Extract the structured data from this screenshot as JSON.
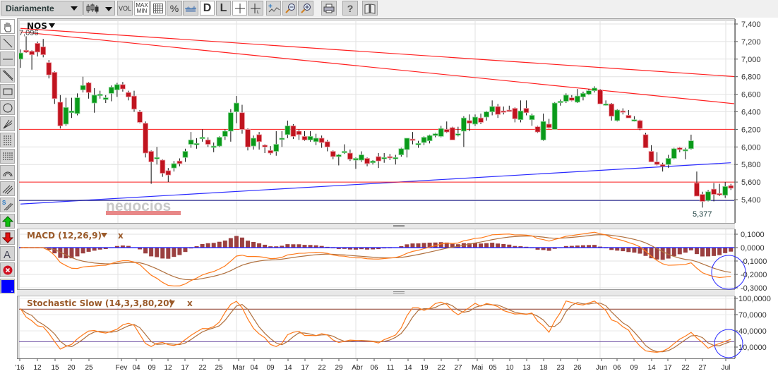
{
  "toolbar": {
    "period": "Diariamente",
    "vol": "VOL",
    "max": "MAX",
    "min": "MIN",
    "percent": "%",
    "d": "D",
    "l": "L",
    "help": "?"
  },
  "chart": {
    "symbol": "NOS",
    "high_label": "7,096",
    "low_label": "5,377",
    "watermark": "negocios"
  },
  "macd": {
    "title": "MACD (12,26,9)",
    "close": "x"
  },
  "stoch": {
    "title": "Stochastic Slow (14,3,3,80,20)",
    "close": "x"
  },
  "colors": {
    "up": "#0a9a1a",
    "down": "#c0141f",
    "trend": "#ff2020",
    "support": "#2a2aff",
    "macd": "#ff7a1a",
    "signal": "#b0703e",
    "hist": "#9b4040",
    "stoch_hi": "#8b3a2a",
    "stoch_lo": "#6a4aa0",
    "selected_color": "#0000ff"
  },
  "chart_data": [
    {
      "type": "candlestick",
      "title": "NOS",
      "ylim": [
        5.2,
        7.45
      ],
      "y_ticks": [
        "7,400",
        "7,200",
        "7,000",
        "6,800",
        "6,600",
        "6,400",
        "6,200",
        "6,000",
        "5,800",
        "5,600",
        "5,400"
      ],
      "y_tick_values": [
        7.4,
        7.2,
        7.0,
        6.8,
        6.6,
        6.4,
        6.2,
        6.0,
        5.8,
        5.6,
        5.4
      ],
      "x_ticks": [
        "'16",
        "12",
        "15",
        "20",
        "25",
        "Fev",
        "04",
        "09",
        "12",
        "17",
        "22",
        "25",
        "Mar",
        "04",
        "09",
        "14",
        "17",
        "22",
        "29",
        "Abr",
        "06",
        "11",
        "14",
        "19",
        "22",
        "27",
        "Mai",
        "05",
        "10",
        "13",
        "18",
        "23",
        "26",
        "Jun",
        "06",
        "09",
        "14",
        "17",
        "22",
        "27",
        "Jul"
      ],
      "trendlines": [
        {
          "from": [
            0,
            7.35
          ],
          "to": [
            126,
            6.8
          ],
          "color": "red"
        },
        {
          "from": [
            0,
            7.31
          ],
          "to": [
            126,
            6.49
          ],
          "color": "red"
        },
        {
          "from": [
            0,
            5.35
          ],
          "to": [
            125,
            5.82
          ],
          "color": "blue"
        }
      ],
      "hlines": [
        {
          "value": 6.2,
          "color": "red"
        },
        {
          "value": 5.6,
          "color": "red"
        },
        {
          "value": 5.39,
          "color": "darkblue"
        }
      ],
      "ohlc": [
        [
          7.0,
          7.11,
          6.9,
          7.07
        ],
        [
          7.1,
          7.26,
          7.07,
          7.08
        ],
        [
          7.09,
          7.1,
          6.88,
          7.05
        ],
        [
          7.18,
          7.2,
          7.03,
          7.08
        ],
        [
          7.14,
          7.23,
          7.02,
          7.05
        ],
        [
          6.96,
          6.99,
          6.78,
          6.82
        ],
        [
          6.85,
          6.86,
          6.49,
          6.55
        ],
        [
          6.51,
          6.59,
          6.21,
          6.24
        ],
        [
          6.26,
          6.56,
          6.24,
          6.45
        ],
        [
          6.39,
          6.56,
          6.33,
          6.41
        ],
        [
          6.38,
          6.61,
          6.36,
          6.56
        ],
        [
          6.65,
          6.8,
          6.62,
          6.7
        ],
        [
          6.73,
          6.74,
          6.55,
          6.62
        ],
        [
          6.5,
          6.67,
          6.39,
          6.59
        ],
        [
          6.6,
          6.64,
          6.55,
          6.6
        ],
        [
          6.54,
          6.59,
          6.5,
          6.56
        ],
        [
          6.61,
          6.7,
          6.52,
          6.68
        ],
        [
          6.65,
          6.73,
          6.57,
          6.71
        ],
        [
          6.71,
          6.74,
          6.63,
          6.66
        ],
        [
          6.62,
          6.64,
          6.53,
          6.57
        ],
        [
          6.58,
          6.64,
          6.4,
          6.43
        ],
        [
          6.4,
          6.42,
          6.27,
          6.28
        ],
        [
          6.27,
          6.29,
          5.88,
          5.93
        ],
        [
          5.95,
          5.96,
          5.58,
          5.83
        ],
        [
          5.88,
          6.0,
          5.8,
          5.88
        ],
        [
          5.85,
          5.86,
          5.66,
          5.7
        ],
        [
          5.73,
          5.76,
          5.6,
          5.68
        ],
        [
          5.76,
          5.84,
          5.72,
          5.81
        ],
        [
          5.84,
          5.87,
          5.78,
          5.81
        ],
        [
          5.88,
          5.98,
          5.83,
          5.95
        ],
        [
          6.03,
          6.17,
          5.99,
          6.08
        ],
        [
          6.04,
          6.1,
          5.98,
          6.04
        ],
        [
          6.11,
          6.2,
          6.06,
          6.11
        ],
        [
          6.08,
          6.11,
          6.0,
          6.03
        ],
        [
          6.01,
          6.05,
          5.94,
          6.01
        ],
        [
          6.01,
          6.12,
          6.0,
          6.11
        ],
        [
          6.12,
          6.2,
          6.08,
          6.18
        ],
        [
          6.18,
          6.43,
          6.06,
          6.39
        ],
        [
          6.4,
          6.58,
          6.27,
          6.5
        ],
        [
          6.39,
          6.48,
          6.15,
          6.2
        ],
        [
          6.2,
          6.21,
          5.96,
          6.0
        ],
        [
          6.01,
          6.13,
          5.97,
          6.1
        ],
        [
          6.14,
          6.17,
          5.97,
          6.06
        ],
        [
          6.02,
          6.03,
          5.93,
          6.0
        ],
        [
          5.96,
          6.01,
          5.91,
          5.93
        ],
        [
          5.95,
          6.18,
          5.9,
          6.03
        ],
        [
          6.09,
          6.18,
          6.0,
          6.1
        ],
        [
          6.14,
          6.3,
          6.1,
          6.24
        ],
        [
          6.24,
          6.26,
          6.09,
          6.12
        ],
        [
          6.18,
          6.2,
          6.08,
          6.14
        ],
        [
          6.12,
          6.18,
          6.07,
          6.08
        ],
        [
          6.08,
          6.18,
          6.06,
          6.12
        ],
        [
          6.06,
          6.15,
          6.02,
          6.1
        ],
        [
          6.1,
          6.13,
          5.99,
          6.05
        ],
        [
          6.06,
          6.08,
          5.95,
          6.0
        ],
        [
          5.95,
          5.96,
          5.86,
          5.89
        ],
        [
          5.89,
          5.92,
          5.79,
          5.91
        ],
        [
          5.94,
          6.03,
          5.92,
          5.95
        ],
        [
          5.93,
          5.97,
          5.84,
          5.86
        ],
        [
          5.85,
          5.88,
          5.75,
          5.87
        ],
        [
          5.85,
          5.95,
          5.83,
          5.91
        ],
        [
          5.87,
          5.88,
          5.78,
          5.81
        ],
        [
          5.82,
          5.85,
          5.8,
          5.84
        ],
        [
          5.89,
          5.93,
          5.76,
          5.84
        ],
        [
          5.87,
          5.93,
          5.82,
          5.88
        ],
        [
          5.89,
          5.92,
          5.85,
          5.88
        ],
        [
          5.87,
          5.91,
          5.8,
          5.88
        ],
        [
          5.91,
          5.99,
          5.89,
          5.98
        ],
        [
          5.97,
          6.1,
          5.88,
          6.1
        ],
        [
          6.09,
          6.17,
          6.03,
          6.08
        ],
        [
          6.03,
          6.07,
          5.99,
          6.04
        ],
        [
          6.05,
          6.12,
          6.02,
          6.11
        ],
        [
          6.07,
          6.14,
          6.04,
          6.13
        ],
        [
          6.13,
          6.16,
          6.11,
          6.15
        ],
        [
          6.12,
          6.24,
          6.11,
          6.21
        ],
        [
          6.2,
          6.29,
          6.16,
          6.17
        ],
        [
          6.22,
          6.23,
          6.08,
          6.08
        ],
        [
          6.14,
          6.23,
          6.12,
          6.15
        ],
        [
          6.18,
          6.35,
          6.0,
          6.33
        ],
        [
          6.3,
          6.37,
          6.18,
          6.27
        ],
        [
          6.26,
          6.37,
          6.24,
          6.34
        ],
        [
          6.33,
          6.38,
          6.26,
          6.28
        ],
        [
          6.34,
          6.41,
          6.3,
          6.4
        ],
        [
          6.4,
          6.53,
          6.36,
          6.46
        ],
        [
          6.46,
          6.49,
          6.33,
          6.37
        ],
        [
          6.41,
          6.46,
          6.37,
          6.4
        ],
        [
          6.42,
          6.47,
          6.4,
          6.41
        ],
        [
          6.44,
          6.45,
          6.28,
          6.32
        ],
        [
          6.31,
          6.53,
          6.28,
          6.41
        ],
        [
          6.44,
          6.53,
          6.36,
          6.39
        ],
        [
          6.31,
          6.38,
          6.24,
          6.36
        ],
        [
          6.23,
          6.24,
          6.16,
          6.17
        ],
        [
          6.08,
          6.38,
          6.07,
          6.29
        ],
        [
          6.26,
          6.32,
          6.21,
          6.22
        ],
        [
          6.2,
          6.51,
          6.2,
          6.5
        ],
        [
          6.51,
          6.54,
          6.47,
          6.52
        ],
        [
          6.52,
          6.61,
          6.5,
          6.59
        ],
        [
          6.56,
          6.59,
          6.52,
          6.53
        ],
        [
          6.51,
          6.66,
          6.5,
          6.58
        ],
        [
          6.57,
          6.63,
          6.53,
          6.61
        ],
        [
          6.6,
          6.66,
          6.59,
          6.64
        ],
        [
          6.64,
          6.69,
          6.62,
          6.67
        ],
        [
          6.65,
          6.66,
          6.49,
          6.49
        ],
        [
          6.48,
          6.53,
          6.47,
          6.49
        ],
        [
          6.49,
          6.5,
          6.3,
          6.35
        ],
        [
          6.3,
          6.43,
          6.29,
          6.42
        ],
        [
          6.41,
          6.44,
          6.37,
          6.4
        ],
        [
          6.36,
          6.42,
          6.33,
          6.33
        ],
        [
          6.3,
          6.35,
          6.29,
          6.31
        ],
        [
          6.3,
          6.31,
          6.19,
          6.21
        ],
        [
          6.14,
          6.16,
          5.99,
          5.99
        ],
        [
          5.95,
          6.02,
          5.83,
          5.83
        ],
        [
          5.83,
          5.94,
          5.79,
          5.8
        ],
        [
          5.8,
          5.82,
          5.72,
          5.78
        ],
        [
          5.8,
          5.91,
          5.76,
          5.87
        ],
        [
          5.87,
          5.99,
          5.86,
          5.98
        ],
        [
          5.99,
          6.0,
          5.94,
          5.97
        ],
        [
          5.96,
          5.99,
          5.86,
          5.97
        ],
        [
          5.98,
          6.14,
          5.97,
          6.07
        ],
        [
          5.59,
          5.72,
          5.44,
          5.44
        ],
        [
          5.46,
          5.49,
          5.31,
          5.38
        ],
        [
          5.39,
          5.51,
          5.38,
          5.49
        ],
        [
          5.52,
          5.59,
          5.38,
          5.46
        ],
        [
          5.47,
          5.58,
          5.44,
          5.46
        ],
        [
          5.45,
          5.6,
          5.42,
          5.55
        ],
        [
          5.56,
          5.58,
          5.51,
          5.53
        ]
      ]
    },
    {
      "type": "line",
      "title": "MACD (12,26,9)",
      "params": [
        12,
        26,
        9
      ],
      "series": [
        "MACD",
        "Signal",
        "Histogram"
      ],
      "ylim": [
        -0.31,
        0.11
      ],
      "y_ticks": [
        "0,1000",
        "0,0000",
        "-0,1000",
        "-0,2000",
        "-0,3000"
      ],
      "y_tick_values": [
        0.1,
        0,
        -0.1,
        -0.2,
        -0.3
      ]
    },
    {
      "type": "line",
      "title": "Stochastic Slow (14,3,3,80,20)",
      "params": [
        14,
        3,
        3
      ],
      "levels": [
        80,
        20
      ],
      "series": [
        "%K",
        "%D"
      ],
      "ylim": [
        0,
        100
      ],
      "y_ticks": [
        "100,0000",
        "70,0000",
        "40,0000",
        "10,0000"
      ],
      "y_tick_values": [
        100,
        70,
        40,
        10
      ]
    }
  ]
}
